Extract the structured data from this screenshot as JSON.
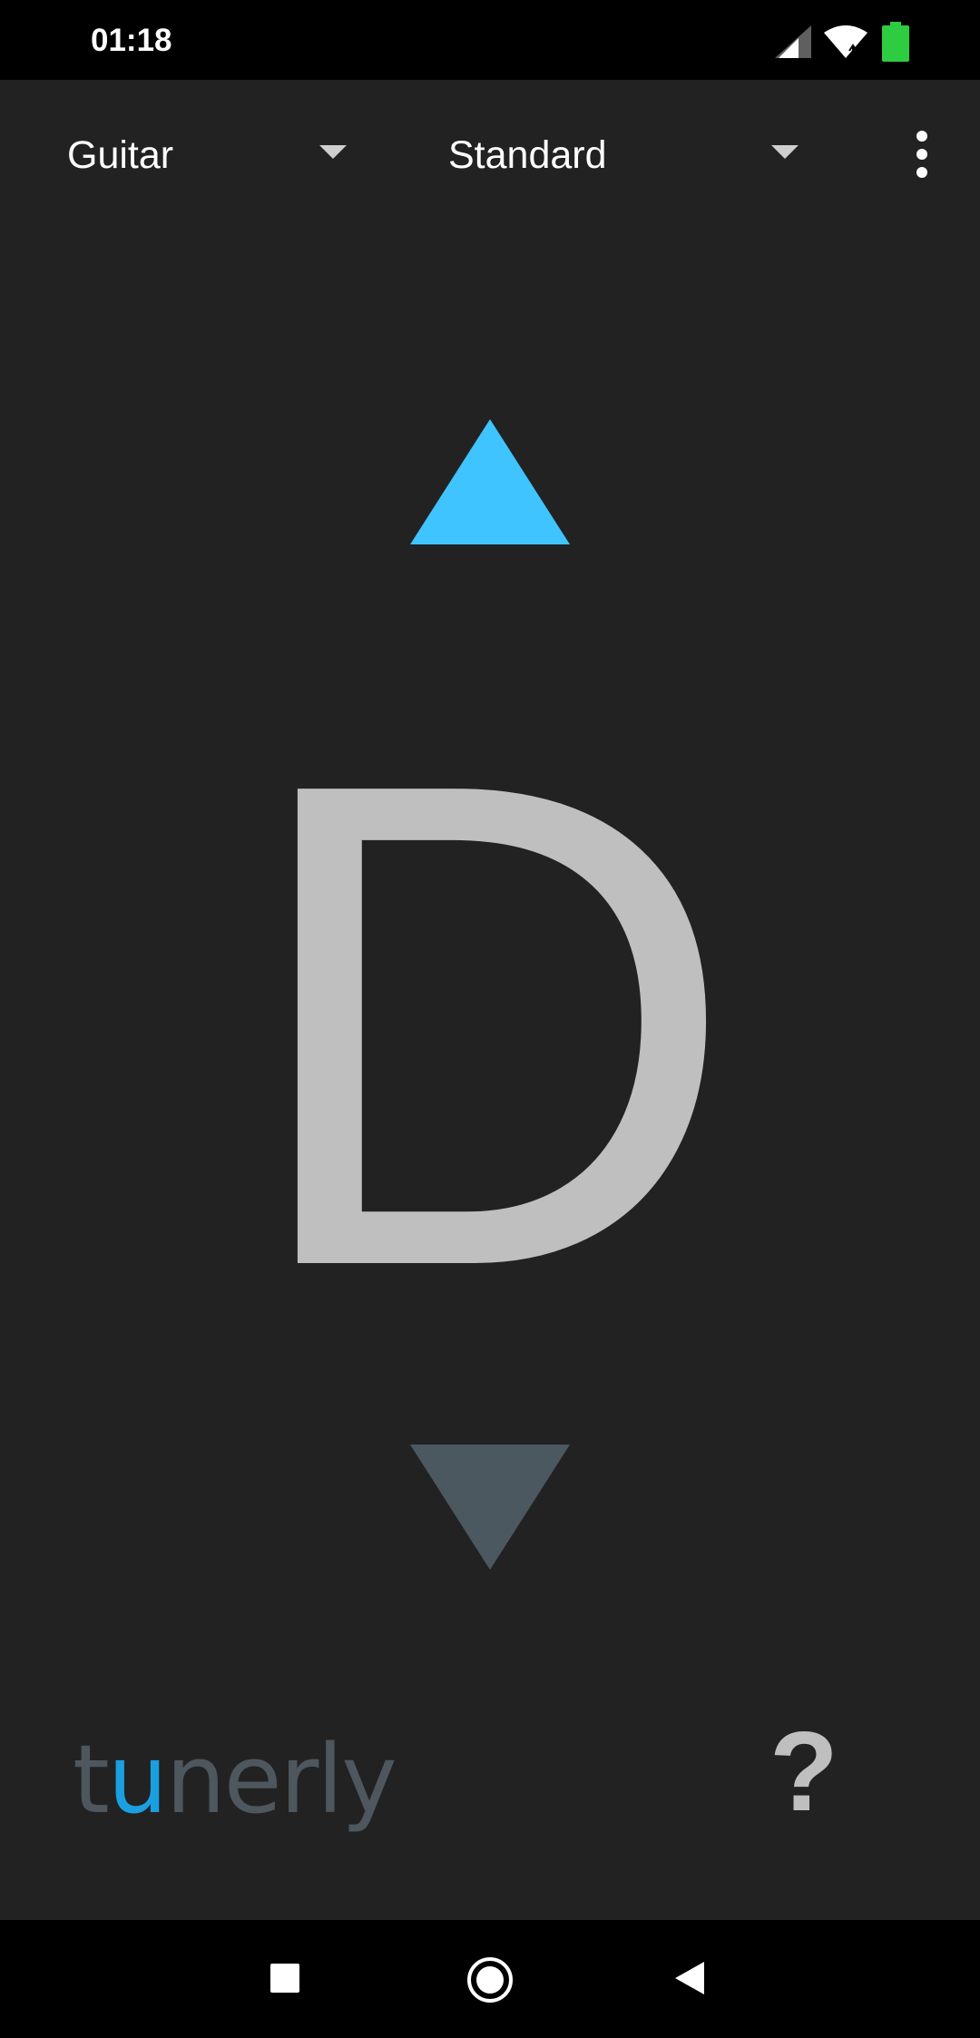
{
  "status_bar": {
    "time": "01:18",
    "icons": [
      "signal-icon",
      "wifi-icon",
      "battery-icon"
    ],
    "battery_color": "#2ecc40"
  },
  "toolbar": {
    "instrument_label": "Guitar",
    "tuning_label": "Standard",
    "more_icon": "more-vert-icon"
  },
  "tuner": {
    "note": "D",
    "sharp_arrow_color": "#40c4ff",
    "flat_arrow_color": "#4b5860",
    "note_color": "#bfbfbf",
    "active_direction": "up"
  },
  "footer": {
    "logo_t": "t",
    "logo_u": "u",
    "logo_rest": "nerly",
    "logo_accent_color": "#1a9fe0",
    "help_label": "?"
  },
  "nav_bar": {
    "buttons": [
      "recents-icon",
      "home-icon",
      "back-icon"
    ]
  }
}
